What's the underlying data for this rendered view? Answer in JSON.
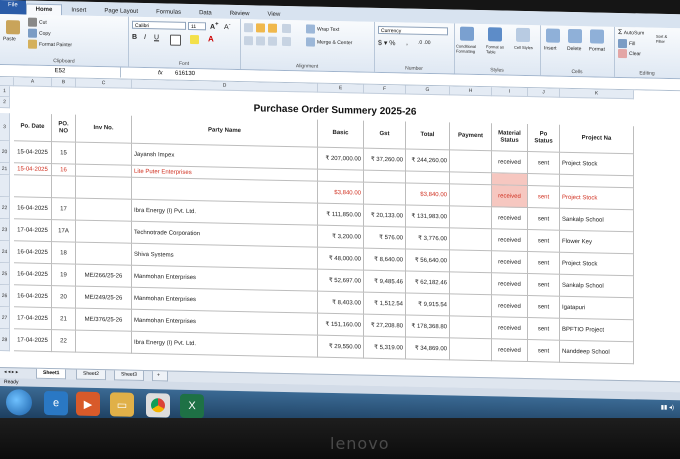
{
  "ribbon": {
    "tabs": [
      "File",
      "Home",
      "Insert",
      "Page Layout",
      "Formulas",
      "Data",
      "Review",
      "View"
    ],
    "clipboard": {
      "cut": "Cut",
      "copy": "Copy",
      "format_painter": "Format Painter",
      "paste": "Paste",
      "label": "Clipboard"
    },
    "font": {
      "name": "Calibri",
      "size": "11",
      "label": "Font"
    },
    "alignment": {
      "wrap": "Wrap Text",
      "merge": "Merge & Center",
      "label": "Alignment"
    },
    "number": {
      "format": "Currency",
      "label": "Number"
    },
    "styles": {
      "conditional": "Conditional Formatting",
      "table": "Format as Table",
      "cell": "Cell Styles",
      "label": "Styles"
    },
    "cells": {
      "insert": "Insert",
      "delete": "Delete",
      "format": "Format",
      "label": "Cells"
    },
    "editing": {
      "autosum": "AutoSum",
      "fill": "Fill",
      "clear": "Clear",
      "sort": "Sort & Filter",
      "label": "Editing"
    }
  },
  "formula_bar": {
    "name_box": "E52",
    "fx": "fx",
    "value": "616130"
  },
  "sheet": {
    "col_letters": [
      "A",
      "B",
      "C",
      "D",
      "E",
      "F",
      "G",
      "H",
      "I",
      "J",
      "K"
    ],
    "title": "Purchase Order Summery 2025-26",
    "headers": [
      "Po. Date",
      "PO. NO",
      "Inv No.",
      "Party Name",
      "Basic",
      "Gst",
      "Total",
      "Payment",
      "Material Status",
      "Po Status",
      "Project Na"
    ],
    "rows": [
      {
        "num": "20",
        "date": "15-04-2025",
        "po": "15",
        "inv": "",
        "party": "Jayansh Impex",
        "basic": "₹ 207,000.00",
        "gst": "₹ 37,260.00",
        "total": "₹ 244,260.00",
        "payment": "",
        "material": "received",
        "status": "sent",
        "project": "Project Stock",
        "red": false
      },
      {
        "num": "21",
        "date": "15-04-2025",
        "po": "16",
        "inv": "",
        "party": "Lite Puter Enterprises",
        "basic": "",
        "gst": "",
        "total": "",
        "payment": "",
        "material": "",
        "status": "",
        "project": "",
        "red": true
      },
      {
        "num": "",
        "date": "",
        "po": "",
        "inv": "",
        "party": "",
        "basic": "$3,840.00",
        "gst": "",
        "total": "$3,840.00",
        "payment": "",
        "material": "received",
        "status": "sent",
        "project": "Project Stock",
        "red": true
      },
      {
        "num": "22",
        "date": "16-04-2025",
        "po": "17",
        "inv": "",
        "party": "Ibra Energy (I) Pvt. Ltd.",
        "basic": "₹ 111,850.00",
        "gst": "₹ 20,133.00",
        "total": "₹ 131,983.00",
        "payment": "",
        "material": "received",
        "status": "sent",
        "project": "Sankalp School",
        "red": false
      },
      {
        "num": "23",
        "date": "17-04-2025",
        "po": "17A",
        "inv": "",
        "party": "Technotrade Corporation",
        "basic": "₹ 3,200.00",
        "gst": "₹ 576.00",
        "total": "₹ 3,776.00",
        "payment": "",
        "material": "received",
        "status": "sent",
        "project": "Flower Key",
        "red": false
      },
      {
        "num": "24",
        "date": "16-04-2025",
        "po": "18",
        "inv": "",
        "party": "Shiva Systems",
        "basic": "₹ 48,000.00",
        "gst": "₹ 8,640.00",
        "total": "₹ 56,640.00",
        "payment": "",
        "material": "received",
        "status": "sent",
        "project": "Project Stock",
        "red": false
      },
      {
        "num": "25",
        "date": "16-04-2025",
        "po": "19",
        "inv": "ME/266/25-26",
        "party": "Manmohan Enterprises",
        "basic": "₹ 52,697.00",
        "gst": "₹ 9,485.46",
        "total": "₹ 62,182.46",
        "payment": "",
        "material": "received",
        "status": "sent",
        "project": "Sankalp School",
        "red": false
      },
      {
        "num": "26",
        "date": "16-04-2025",
        "po": "20",
        "inv": "ME/249/25-26",
        "party": "Manmohan Enterprises",
        "basic": "₹ 8,403.00",
        "gst": "₹ 1,512.54",
        "total": "₹ 9,915.54",
        "payment": "",
        "material": "received",
        "status": "sent",
        "project": "Igatapuri",
        "red": false
      },
      {
        "num": "27",
        "date": "17-04-2025",
        "po": "21",
        "inv": "ME/376/25-26",
        "party": "Manmohan Enterprises",
        "basic": "₹ 151,160.00",
        "gst": "₹ 27,208.80",
        "total": "₹ 178,368.80",
        "payment": "",
        "material": "received",
        "status": "sent",
        "project": "BPFTIO Project",
        "red": false
      },
      {
        "num": "28",
        "date": "17-04-2025",
        "po": "22",
        "inv": "",
        "party": "Ibra Energy (I) Pvt. Ltd.",
        "basic": "₹ 29,550.00",
        "gst": "₹ 5,319.00",
        "total": "₹ 34,869.00",
        "payment": "",
        "material": "received",
        "status": "sent",
        "project": "Nanddeep School",
        "red": false
      }
    ]
  },
  "sheet_tabs": [
    "Sheet1",
    "Sheet2",
    "Sheet3"
  ],
  "status_bar": "Ready",
  "bezel_brand": "lenovo"
}
